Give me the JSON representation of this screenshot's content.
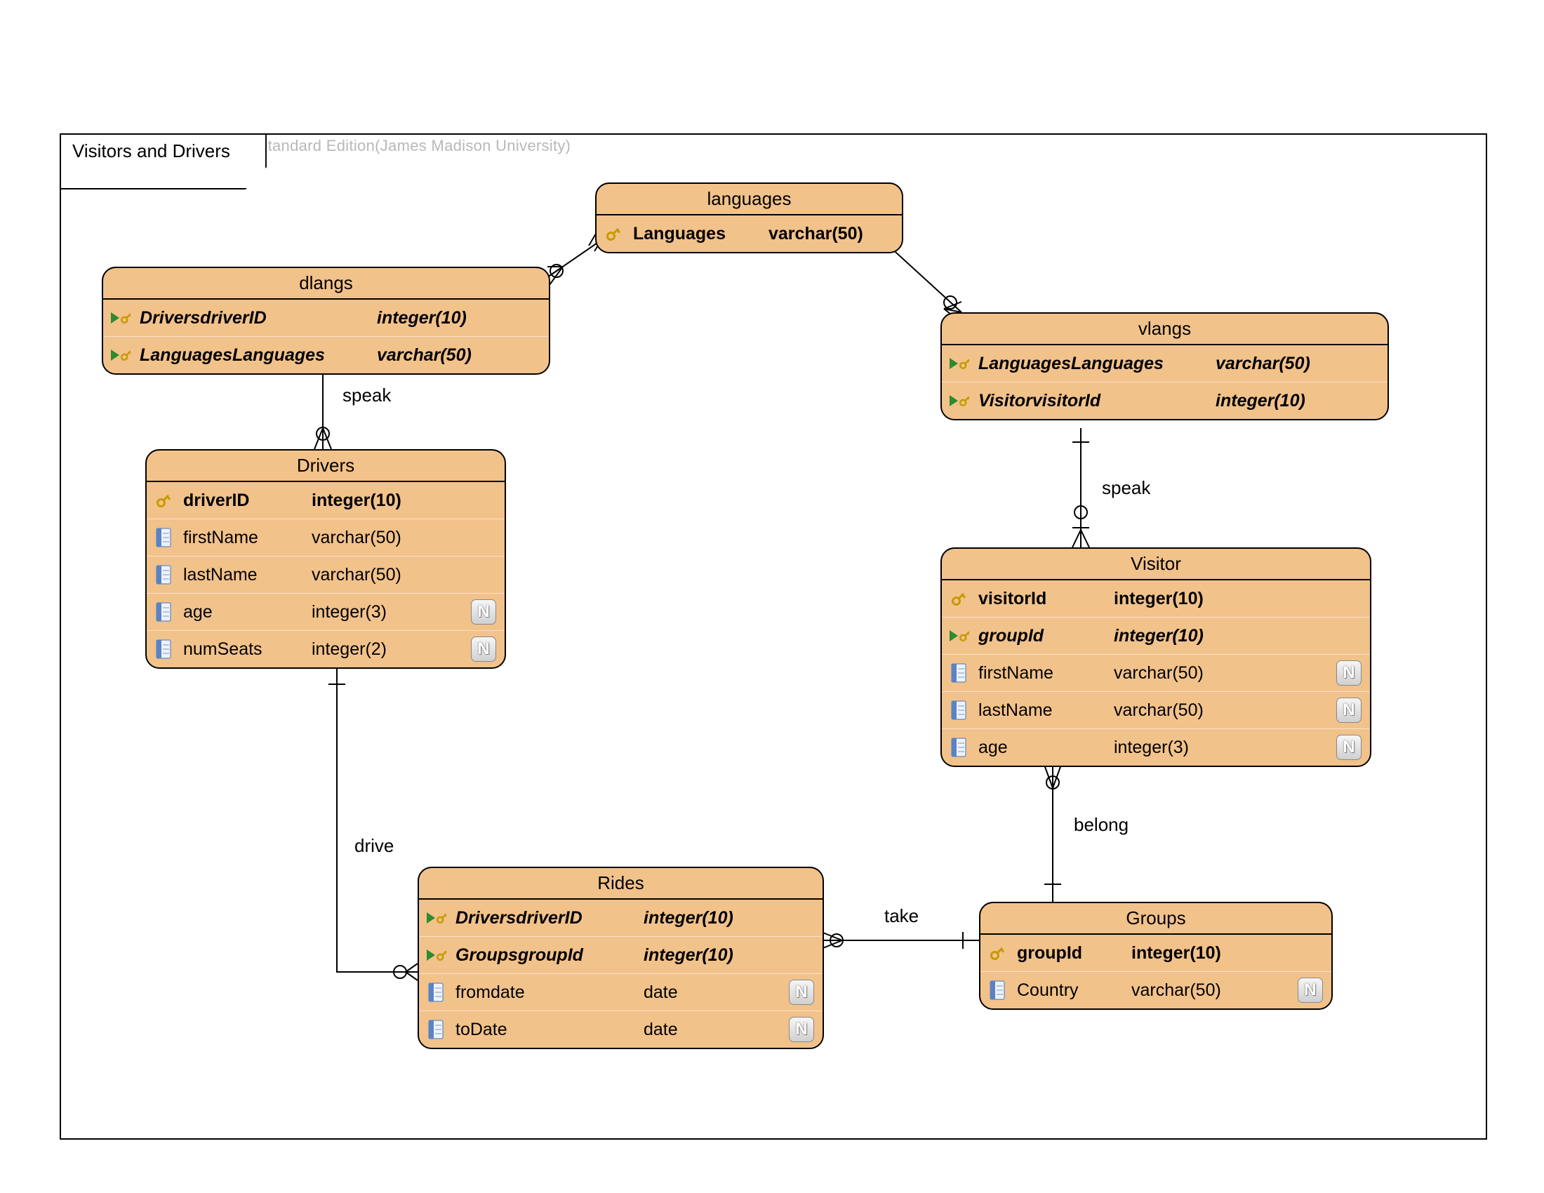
{
  "watermark": "Visual Paradigm for UML Standard Edition(James Madison University)",
  "frame_title": "Visitors and Drivers",
  "entities": {
    "languages": {
      "title": "languages",
      "cols": [
        {
          "icon": "pk",
          "name": "Languages",
          "type": "varchar(50)",
          "n": false,
          "style": "pk"
        }
      ]
    },
    "dlangs": {
      "title": "dlangs",
      "cols": [
        {
          "icon": "fk",
          "name": "DriversdriverID",
          "type": "integer(10)",
          "n": false,
          "style": "fk"
        },
        {
          "icon": "fk",
          "name": "LanguagesLanguages",
          "type": "varchar(50)",
          "n": false,
          "style": "fk"
        }
      ]
    },
    "vlangs": {
      "title": "vlangs",
      "cols": [
        {
          "icon": "fk",
          "name": "LanguagesLanguages",
          "type": "varchar(50)",
          "n": false,
          "style": "fk"
        },
        {
          "icon": "fk",
          "name": "VisitorvisitorId",
          "type": "integer(10)",
          "n": false,
          "style": "fk"
        }
      ]
    },
    "drivers": {
      "title": "Drivers",
      "cols": [
        {
          "icon": "pk",
          "name": "driverID",
          "type": "integer(10)",
          "n": false,
          "style": "pk"
        },
        {
          "icon": "col",
          "name": "firstName",
          "type": "varchar(50)",
          "n": false,
          "style": ""
        },
        {
          "icon": "col",
          "name": "lastName",
          "type": "varchar(50)",
          "n": false,
          "style": ""
        },
        {
          "icon": "col",
          "name": "age",
          "type": "integer(3)",
          "n": true,
          "style": ""
        },
        {
          "icon": "col",
          "name": "numSeats",
          "type": "integer(2)",
          "n": true,
          "style": ""
        }
      ]
    },
    "visitor": {
      "title": "Visitor",
      "cols": [
        {
          "icon": "pk",
          "name": "visitorId",
          "type": "integer(10)",
          "n": false,
          "style": "pk"
        },
        {
          "icon": "fk2",
          "name": "groupId",
          "type": "integer(10)",
          "n": false,
          "style": "fk"
        },
        {
          "icon": "col",
          "name": "firstName",
          "type": "varchar(50)",
          "n": true,
          "style": ""
        },
        {
          "icon": "col",
          "name": "lastName",
          "type": "varchar(50)",
          "n": true,
          "style": ""
        },
        {
          "icon": "col",
          "name": "age",
          "type": "integer(3)",
          "n": true,
          "style": ""
        }
      ]
    },
    "rides": {
      "title": "Rides",
      "cols": [
        {
          "icon": "fk",
          "name": "DriversdriverID",
          "type": "integer(10)",
          "n": false,
          "style": "fk"
        },
        {
          "icon": "fk",
          "name": "GroupsgroupId",
          "type": "integer(10)",
          "n": false,
          "style": "fk"
        },
        {
          "icon": "col",
          "name": "fromdate",
          "type": "date",
          "n": true,
          "style": ""
        },
        {
          "icon": "col",
          "name": "toDate",
          "type": "date",
          "n": true,
          "style": ""
        }
      ]
    },
    "groups": {
      "title": "Groups",
      "cols": [
        {
          "icon": "pk",
          "name": "groupId",
          "type": "integer(10)",
          "n": false,
          "style": "pk"
        },
        {
          "icon": "col",
          "name": "Country",
          "type": "varchar(50)",
          "n": true,
          "style": ""
        }
      ]
    }
  },
  "labels": {
    "speak1": "speak",
    "speak2": "speak",
    "drive": "drive",
    "take": "take",
    "belong": "belong"
  }
}
